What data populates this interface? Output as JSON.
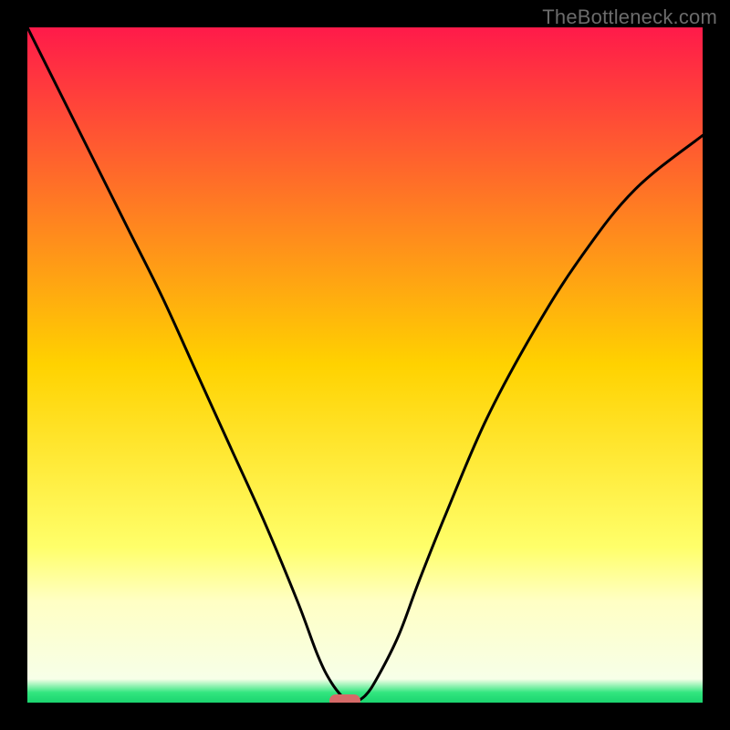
{
  "watermark": "TheBottleneck.com",
  "chart_data": {
    "type": "line",
    "title": "",
    "xlabel": "",
    "ylabel": "",
    "xlim": [
      0,
      100
    ],
    "ylim": [
      0,
      100
    ],
    "gradient_stops": [
      {
        "offset": 0.0,
        "color": "#ff1a4a"
      },
      {
        "offset": 0.5,
        "color": "#ffd200"
      },
      {
        "offset": 0.77,
        "color": "#ffff6a"
      },
      {
        "offset": 0.85,
        "color": "#ffffc4"
      },
      {
        "offset": 0.965,
        "color": "#f7ffe8"
      },
      {
        "offset": 0.985,
        "color": "#32e67f"
      },
      {
        "offset": 1.0,
        "color": "#1bd46f"
      }
    ],
    "series": [
      {
        "name": "bottleneck-curve",
        "x": [
          0,
          5,
          10,
          15,
          20,
          25,
          30,
          35,
          40,
          43,
          45,
          47,
          48,
          50,
          52,
          55,
          58,
          62,
          68,
          75,
          82,
          90,
          100
        ],
        "values": [
          100,
          90,
          80,
          70,
          60,
          49,
          38,
          27,
          15,
          7,
          3,
          0.5,
          0,
          1,
          4,
          10,
          18,
          28,
          42,
          55,
          66,
          76,
          84
        ]
      }
    ],
    "marker": {
      "x": 47,
      "y": 0,
      "color": "#d66a68"
    },
    "legend": [],
    "grid": false
  }
}
